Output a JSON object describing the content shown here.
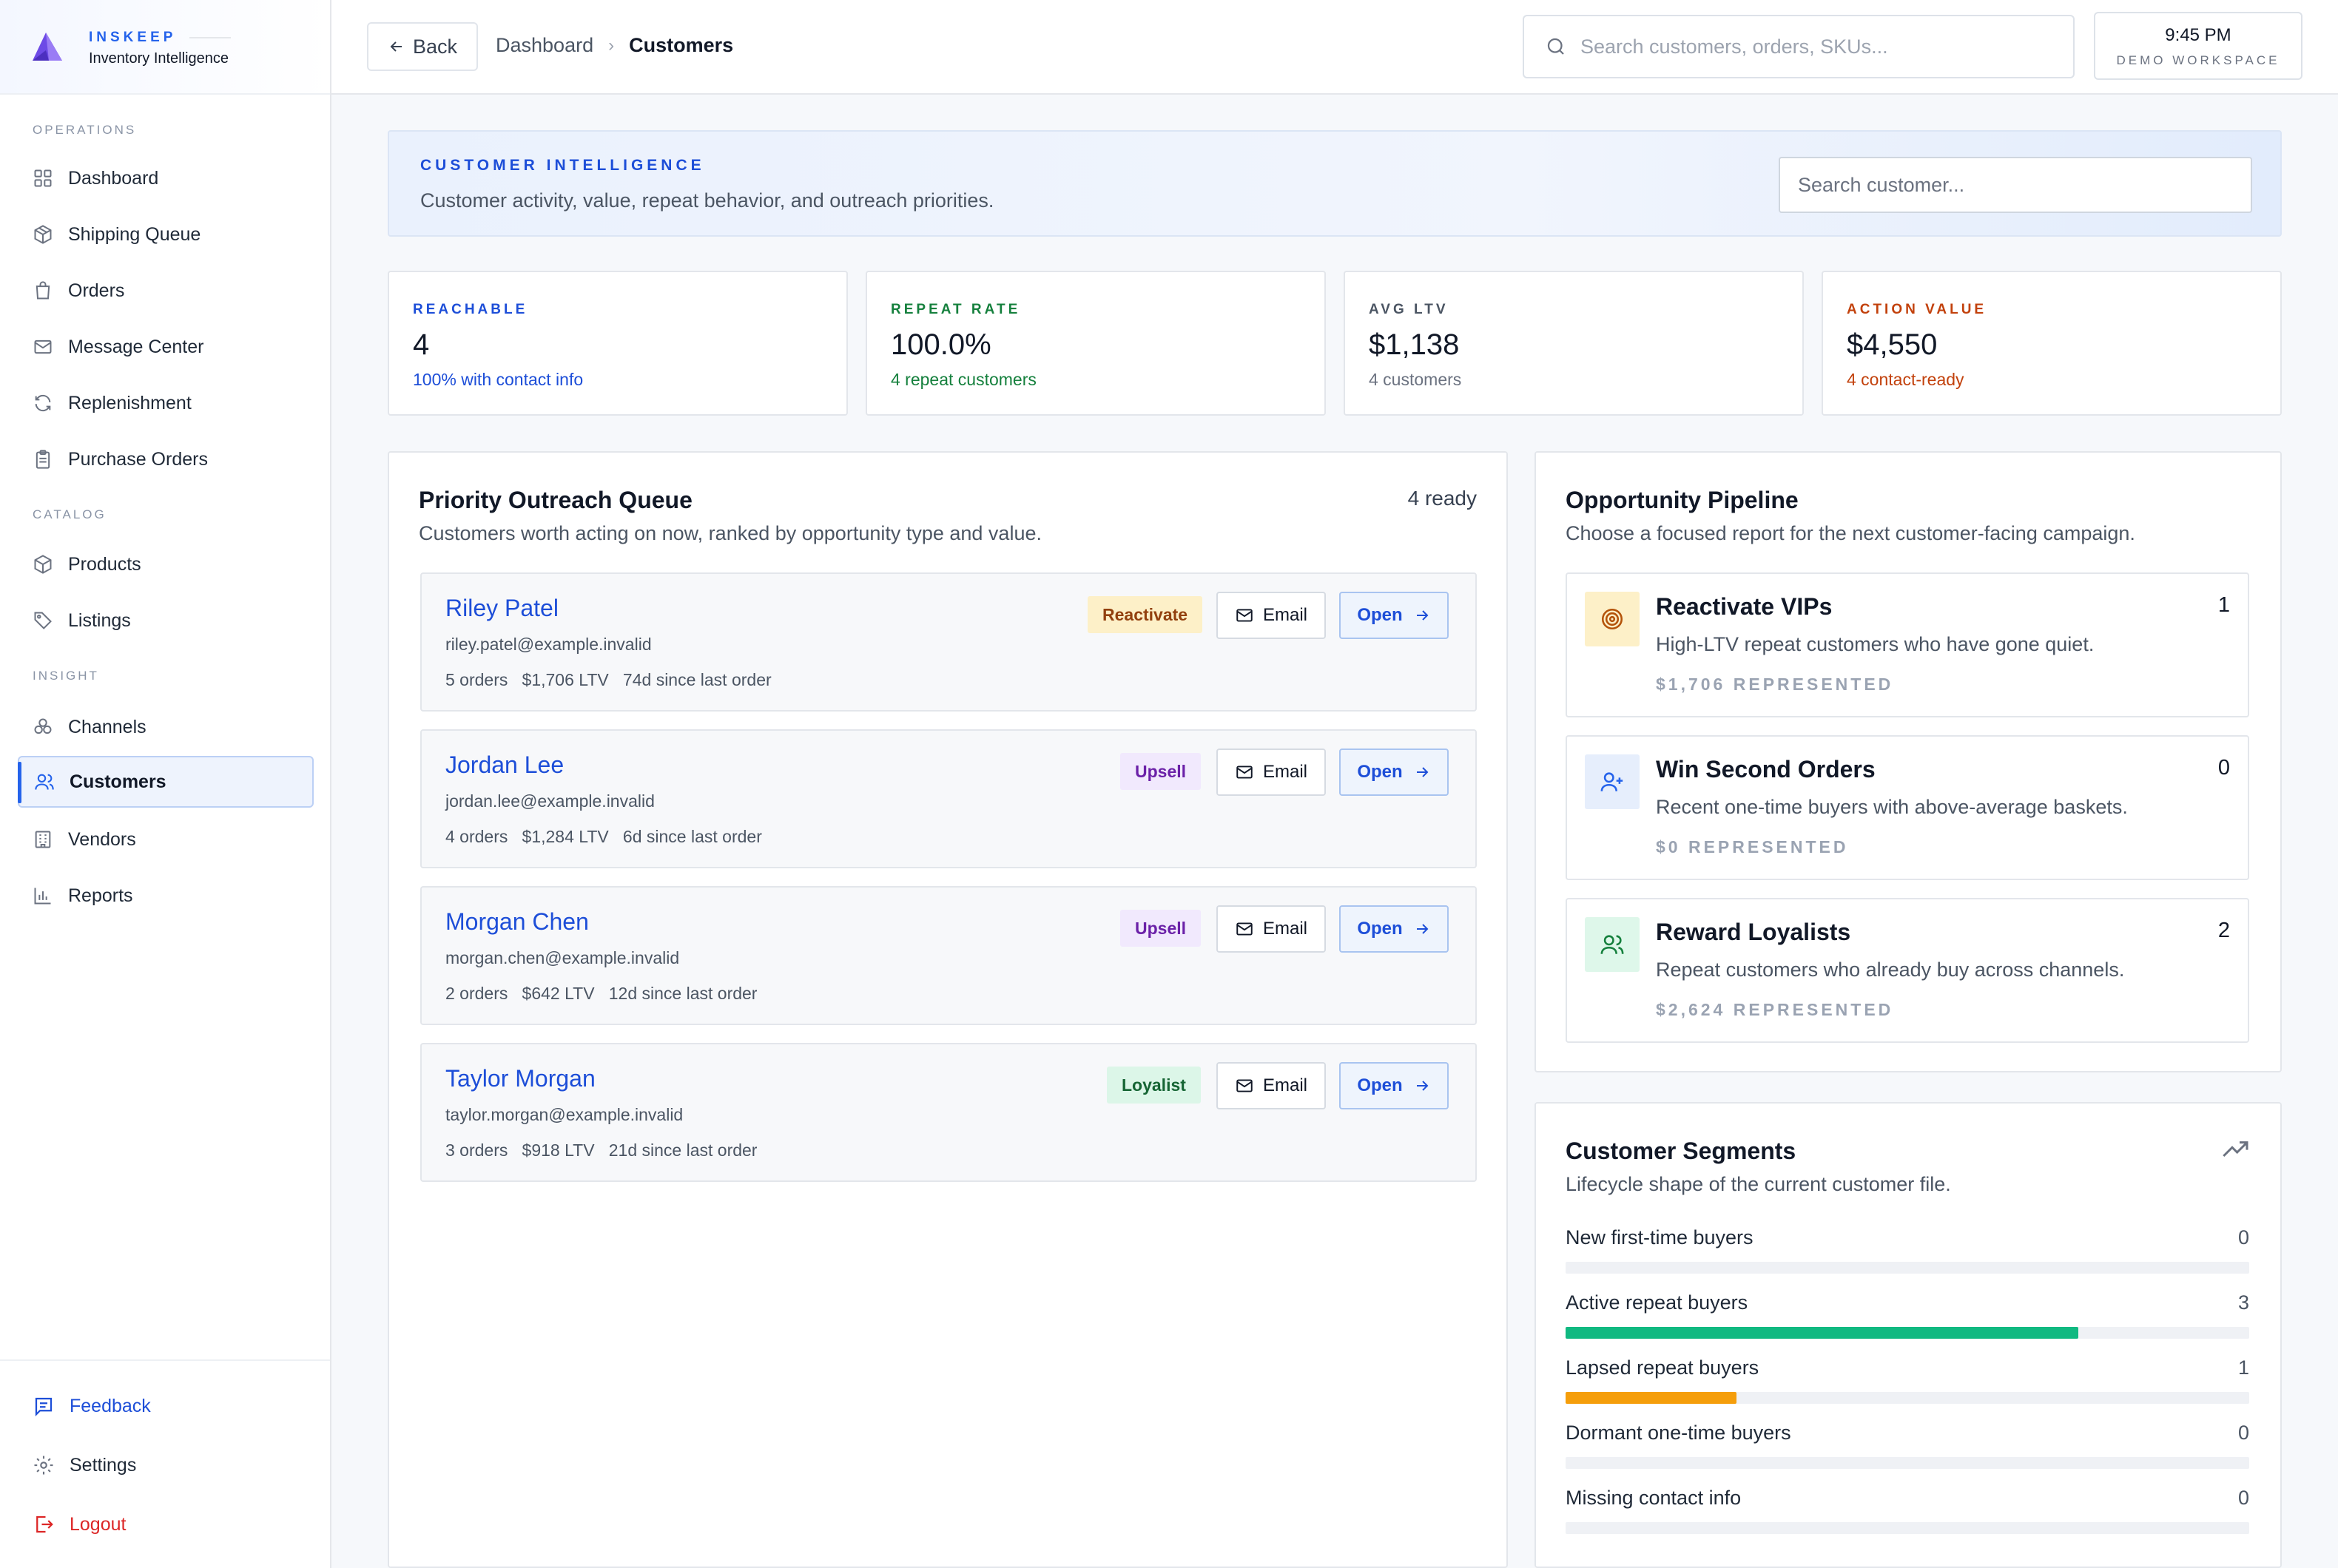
{
  "brand": {
    "name": "INSKEEP",
    "tagline": "Inventory Intelligence"
  },
  "sidebar": {
    "sections": [
      {
        "label": "OPERATIONS",
        "items": [
          {
            "label": "Dashboard",
            "icon": "grid-icon"
          },
          {
            "label": "Shipping Queue",
            "icon": "package-icon"
          },
          {
            "label": "Orders",
            "icon": "bag-icon"
          },
          {
            "label": "Message Center",
            "icon": "mail-icon"
          },
          {
            "label": "Replenishment",
            "icon": "refresh-icon"
          },
          {
            "label": "Purchase Orders",
            "icon": "clipboard-icon"
          }
        ]
      },
      {
        "label": "CATALOG",
        "items": [
          {
            "label": "Products",
            "icon": "box-icon"
          },
          {
            "label": "Listings",
            "icon": "tag-icon"
          }
        ]
      },
      {
        "label": "INSIGHT",
        "items": [
          {
            "label": "Channels",
            "icon": "channels-icon"
          },
          {
            "label": "Customers",
            "icon": "users-icon",
            "active": true
          },
          {
            "label": "Vendors",
            "icon": "building-icon"
          },
          {
            "label": "Reports",
            "icon": "bar-chart-icon"
          }
        ]
      }
    ],
    "footer": {
      "feedback": "Feedback",
      "settings": "Settings",
      "logout": "Logout"
    }
  },
  "topbar": {
    "back_label": "Back",
    "breadcrumb": [
      "Dashboard",
      "Customers"
    ],
    "search_placeholder": "Search customers, orders, SKUs...",
    "time": "9:45 PM",
    "workspace": "DEMO WORKSPACE"
  },
  "hero": {
    "kicker": "CUSTOMER INTELLIGENCE",
    "description": "Customer activity, value, repeat behavior, and outreach priorities.",
    "search_placeholder": "Search customer..."
  },
  "stats": [
    {
      "label": "REACHABLE",
      "value": "4",
      "sub": "100% with contact info",
      "label_color": "#1d4ed8",
      "sub_color": "#1d4ed8"
    },
    {
      "label": "REPEAT RATE",
      "value": "100.0%",
      "sub": "4 repeat customers",
      "label_color": "#15803d",
      "sub_color": "#15803d"
    },
    {
      "label": "AVG LTV",
      "value": "$1,138",
      "sub": "4 customers",
      "label_color": "#4b5563",
      "sub_color": "#6b7280"
    },
    {
      "label": "ACTION VALUE",
      "value": "$4,550",
      "sub": "4 contact-ready",
      "label_color": "#c2410c",
      "sub_color": "#c2410c"
    }
  ],
  "outreach": {
    "title": "Priority Outreach Queue",
    "subtitle": "Customers worth acting on now, ranked by opportunity type and value.",
    "count": "4 ready",
    "email_label": "Email",
    "open_label": "Open",
    "rows": [
      {
        "name": "Riley Patel",
        "email": "riley.patel@example.invalid",
        "meta": "5 orders   $1,706 LTV   74d since last order",
        "badge": "Reactivate",
        "badge_bg": "#fdf0c8",
        "badge_fg": "#92400e"
      },
      {
        "name": "Jordan Lee",
        "email": "jordan.lee@example.invalid",
        "meta": "4 orders   $1,284 LTV   6d since last order",
        "badge": "Upsell",
        "badge_bg": "#f1e9fd",
        "badge_fg": "#6b21a8"
      },
      {
        "name": "Morgan Chen",
        "email": "morgan.chen@example.invalid",
        "meta": "2 orders   $642 LTV   12d since last order",
        "badge": "Upsell",
        "badge_bg": "#f1e9fd",
        "badge_fg": "#6b21a8"
      },
      {
        "name": "Taylor Morgan",
        "email": "taylor.morgan@example.invalid",
        "meta": "3 orders   $918 LTV   21d since last order",
        "badge": "Loyalist",
        "badge_bg": "#dcf6e8",
        "badge_fg": "#166534"
      }
    ]
  },
  "pipeline": {
    "title": "Opportunity Pipeline",
    "subtitle": "Choose a focused report for the next customer-facing campaign.",
    "items": [
      {
        "title": "Reactivate VIPs",
        "desc": "High-LTV repeat customers who have gone quiet.",
        "represented": "$1,706 REPRESENTED",
        "count": "1",
        "icon": "target-icon",
        "icon_bg": "#fdf0c8",
        "icon_fg": "#b45309"
      },
      {
        "title": "Win Second Orders",
        "desc": "Recent one-time buyers with above-average baskets.",
        "represented": "$0 REPRESENTED",
        "count": "0",
        "icon": "user-plus-icon",
        "icon_bg": "#e6eefc",
        "icon_fg": "#2563eb"
      },
      {
        "title": "Reward Loyalists",
        "desc": "Repeat customers who already buy across channels.",
        "represented": "$2,624 REPRESENTED",
        "count": "2",
        "icon": "users-icon",
        "icon_bg": "#def7ea",
        "icon_fg": "#15803d"
      }
    ]
  },
  "segments": {
    "title": "Customer Segments",
    "subtitle": "Lifecycle shape of the current customer file.",
    "icon": "trending-up-icon",
    "total": 4,
    "rows": [
      {
        "label": "New first-time buyers",
        "count": "0",
        "value": 0,
        "color": "#10b981"
      },
      {
        "label": "Active repeat buyers",
        "count": "3",
        "value": 3,
        "color": "#10b981"
      },
      {
        "label": "Lapsed repeat buyers",
        "count": "1",
        "value": 1,
        "color": "#f59e0b"
      },
      {
        "label": "Dormant one-time buyers",
        "count": "0",
        "value": 0,
        "color": "#9ca3af"
      },
      {
        "label": "Missing contact info",
        "count": "0",
        "value": 0,
        "color": "#9ca3af"
      }
    ]
  },
  "colors": {
    "accent": "#2563eb",
    "logout": "#dc2626",
    "brand_logo": "#7c3aed"
  }
}
